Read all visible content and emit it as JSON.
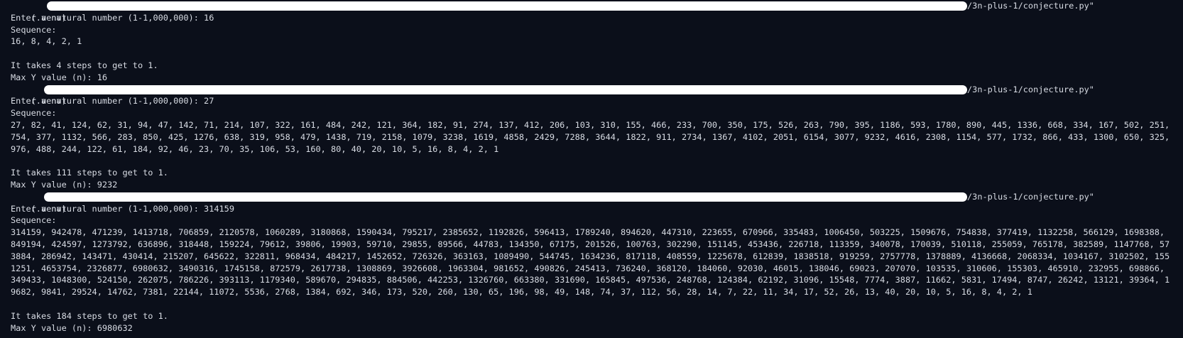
{
  "terminal": {
    "venv": "(.venv)",
    "script_path_tail": "/3n-plus-1/conjecture.py\"",
    "runs": [
      {
        "input_line": "Enter a natural number (1-1,000,000): 16",
        "sequence_label": "Sequence:",
        "sequence": "16, 8, 4, 2, 1",
        "steps_line": "It takes 4 steps to get to 1.",
        "max_line": "Max Y value (n): 16"
      },
      {
        "input_line": "Enter a natural number (1-1,000,000): 27",
        "sequence_label": "Sequence:",
        "sequence": "27, 82, 41, 124, 62, 31, 94, 47, 142, 71, 214, 107, 322, 161, 484, 242, 121, 364, 182, 91, 274, 137, 412, 206, 103, 310, 155, 466, 233, 700, 350, 175, 526, 263, 790, 395, 1186, 593, 1780, 890, 445, 1336, 668, 334, 167, 502, 251, 754, 377, 1132, 566, 283, 850, 425, 1276, 638, 319, 958, 479, 1438, 719, 2158, 1079, 3238, 1619, 4858, 2429, 7288, 3644, 1822, 911, 2734, 1367, 4102, 2051, 6154, 3077, 9232, 4616, 2308, 1154, 577, 1732, 866, 433, 1300, 650, 325, 976, 488, 244, 122, 61, 184, 92, 46, 23, 70, 35, 106, 53, 160, 80, 40, 20, 10, 5, 16, 8, 4, 2, 1",
        "steps_line": "It takes 111 steps to get to 1.",
        "max_line": "Max Y value (n): 9232"
      },
      {
        "input_line": "Enter a natural number (1-1,000,000): 314159",
        "sequence_label": "Sequence:",
        "sequence": "314159, 942478, 471239, 1413718, 706859, 2120578, 1060289, 3180868, 1590434, 795217, 2385652, 1192826, 596413, 1789240, 894620, 447310, 223655, 670966, 335483, 1006450, 503225, 1509676, 754838, 377419, 1132258, 566129, 1698388, 849194, 424597, 1273792, 636896, 318448, 159224, 79612, 39806, 19903, 59710, 29855, 89566, 44783, 134350, 67175, 201526, 100763, 302290, 151145, 453436, 226718, 113359, 340078, 170039, 510118, 255059, 765178, 382589, 1147768, 573884, 286942, 143471, 430414, 215207, 645622, 322811, 968434, 484217, 1452652, 726326, 363163, 1089490, 544745, 1634236, 817118, 408559, 1225678, 612839, 1838518, 919259, 2757778, 1378889, 4136668, 2068334, 1034167, 3102502, 1551251, 4653754, 2326877, 6980632, 3490316, 1745158, 872579, 2617738, 1308869, 3926608, 1963304, 981652, 490826, 245413, 736240, 368120, 184060, 92030, 46015, 138046, 69023, 207070, 103535, 310606, 155303, 465910, 232955, 698866, 349433, 1048300, 524150, 262075, 786226, 393113, 1179340, 589670, 294835, 884506, 442253, 1326760, 663380, 331690, 165845, 497536, 248768, 124384, 62192, 31096, 15548, 7774, 3887, 11662, 5831, 17494, 8747, 26242, 13121, 39364, 19682, 9841, 29524, 14762, 7381, 22144, 11072, 5536, 2768, 1384, 692, 346, 173, 520, 260, 130, 65, 196, 98, 49, 148, 74, 37, 112, 56, 28, 14, 7, 22, 11, 34, 17, 52, 26, 13, 40, 20, 10, 5, 16, 8, 4, 2, 1",
        "steps_line": "It takes 184 steps to get to 1.",
        "max_line": "Max Y value (n): 6980632"
      }
    ]
  }
}
